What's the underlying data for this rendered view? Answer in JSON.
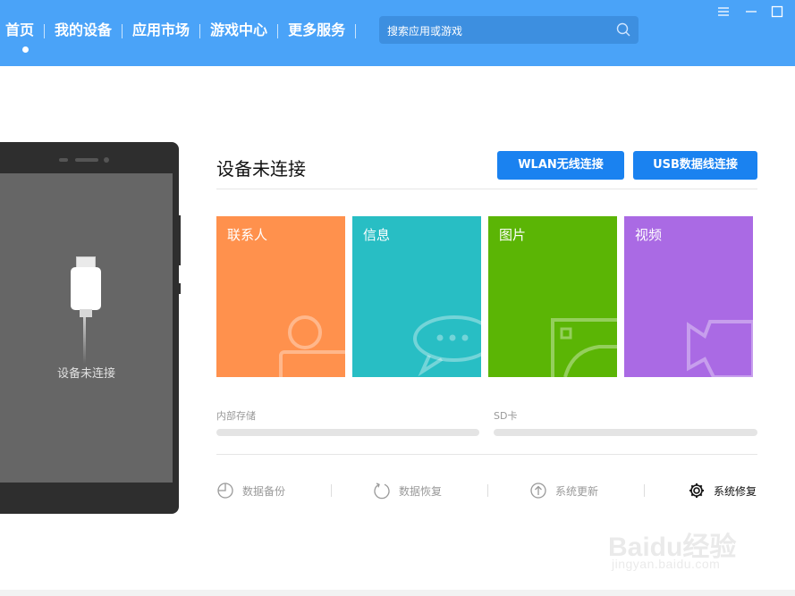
{
  "nav": {
    "items": [
      {
        "label": "首页"
      },
      {
        "label": "我的设备"
      },
      {
        "label": "应用市场"
      },
      {
        "label": "游戏中心"
      },
      {
        "label": "更多服务"
      }
    ]
  },
  "search": {
    "placeholder": "搜索应用或游戏"
  },
  "phone": {
    "status": "设备未连接"
  },
  "main": {
    "title": "设备未连接",
    "wlan_button": "WLAN无线连接",
    "usb_button": "USB数据线连接",
    "tiles": [
      {
        "label": "联系人",
        "color": "#ff914d"
      },
      {
        "label": "信息",
        "color": "#28bec4"
      },
      {
        "label": "图片",
        "color": "#5bb505"
      },
      {
        "label": "视频",
        "color": "#aa6ae4"
      }
    ],
    "storage": {
      "internal": "内部存储",
      "sd": "SD卡"
    },
    "tools": [
      {
        "label": "数据备份"
      },
      {
        "label": "数据恢复"
      },
      {
        "label": "系统更新"
      },
      {
        "label": "系统修复"
      }
    ]
  },
  "watermark": {
    "brand": "Baidu经验",
    "sub": "jingyan.baidu.com"
  },
  "colors": {
    "topbar": "#4aa3f8",
    "accent": "#1a82f0"
  }
}
